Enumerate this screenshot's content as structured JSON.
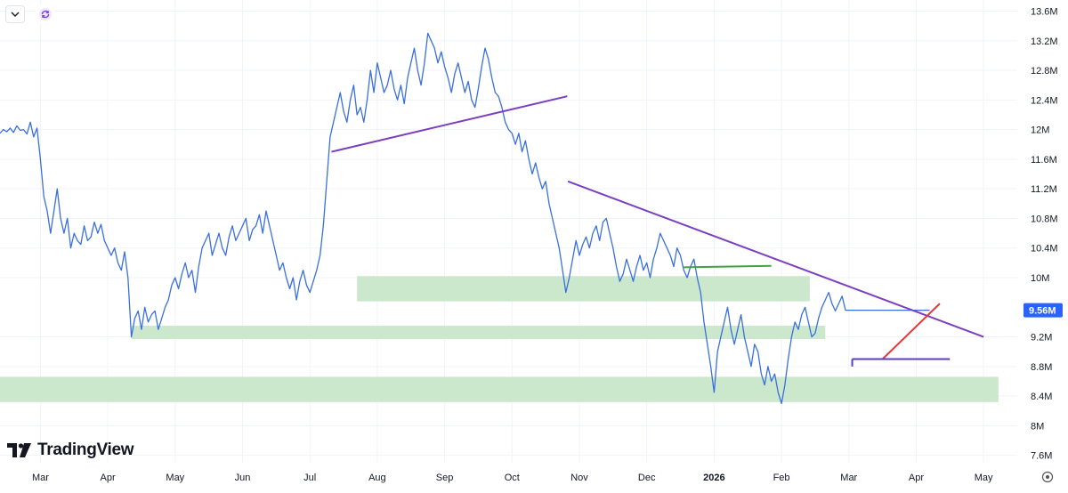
{
  "toolbar": {
    "collapse_icon": "chevron-down-icon",
    "refresh_icon": "refresh-icon"
  },
  "branding": {
    "logo_text": "TradingView",
    "logo_icon": "tradingview-logo-icon"
  },
  "price_axis": {
    "current_price_label": "9.56M",
    "current_price_bg": "#2962ff"
  },
  "settings_icon": "gear-icon",
  "colors": {
    "line": "#3a6fe0",
    "zone": "#c8e6c9",
    "trendline_purple": "#7b3fbf",
    "trendline_green": "#43a047",
    "trendline_red": "#e53935",
    "trendline_indigo": "#5a3ec8",
    "axis_text": "#131722",
    "grid": "#f0f3fa"
  },
  "chart_data": {
    "type": "line",
    "title": "",
    "xlabel": "",
    "ylabel": "",
    "y_tick_labels": [
      "13.6M",
      "13.2M",
      "12.8M",
      "12.4M",
      "12M",
      "11.6M",
      "11.2M",
      "10.8M",
      "10.4M",
      "10M",
      "9.2M",
      "8.8M",
      "8.4M",
      "8M",
      "7.6M"
    ],
    "y_ticks": [
      13.6,
      13.2,
      12.8,
      12.4,
      12.0,
      11.6,
      11.2,
      10.8,
      10.4,
      10.0,
      9.2,
      8.8,
      8.4,
      8.0,
      7.6
    ],
    "ylim": [
      7.5,
      13.75
    ],
    "x_tick_labels": [
      "Mar",
      "Apr",
      "May",
      "Jun",
      "Jul",
      "Aug",
      "Sep",
      "Oct",
      "Nov",
      "Dec",
      "2026",
      "Feb",
      "Mar",
      "Apr",
      "May"
    ],
    "x_tick_months": [
      2,
      3,
      4,
      5,
      6,
      7,
      8,
      9,
      10,
      11,
      12,
      13,
      14,
      15,
      16
    ],
    "x_tick_bold": [
      false,
      false,
      false,
      false,
      false,
      false,
      false,
      false,
      false,
      false,
      true,
      false,
      false,
      false,
      false
    ],
    "xlim": [
      1.4,
      16.5
    ],
    "grid": true,
    "series": [
      {
        "values_x": [
          1.4,
          1.45,
          1.5,
          1.55,
          1.6,
          1.65,
          1.7,
          1.75,
          1.8,
          1.85,
          1.9,
          1.95,
          2.0,
          2.05,
          2.1,
          2.15,
          2.2,
          2.25,
          2.3,
          2.35,
          2.4,
          2.45,
          2.5,
          2.55,
          2.6,
          2.65,
          2.7,
          2.75,
          2.8,
          2.85,
          2.9,
          2.95,
          3.0,
          3.05,
          3.1,
          3.15,
          3.2,
          3.25,
          3.3,
          3.35,
          3.4,
          3.45,
          3.5,
          3.55,
          3.6,
          3.65,
          3.7,
          3.75,
          3.8,
          3.85,
          3.9,
          3.95,
          4.0,
          4.05,
          4.1,
          4.15,
          4.2,
          4.25,
          4.3,
          4.35,
          4.4,
          4.45,
          4.5,
          4.55,
          4.6,
          4.65,
          4.7,
          4.75,
          4.8,
          4.85,
          4.9,
          4.95,
          5.0,
          5.05,
          5.1,
          5.15,
          5.2,
          5.25,
          5.3,
          5.35,
          5.4,
          5.45,
          5.5,
          5.55,
          5.6,
          5.65,
          5.7,
          5.75,
          5.8,
          5.85,
          5.9,
          5.95,
          6.0,
          6.05,
          6.1,
          6.15,
          6.2,
          6.25,
          6.3,
          6.35,
          6.4,
          6.45,
          6.5,
          6.55,
          6.6,
          6.65,
          6.7,
          6.75,
          6.8,
          6.85,
          6.9,
          6.95,
          7.0,
          7.05,
          7.1,
          7.15,
          7.2,
          7.25,
          7.3,
          7.35,
          7.4,
          7.45,
          7.5,
          7.55,
          7.6,
          7.65,
          7.7,
          7.75,
          7.8,
          7.85,
          7.9,
          7.95,
          8.0,
          8.05,
          8.1,
          8.15,
          8.2,
          8.25,
          8.3,
          8.35,
          8.4,
          8.45,
          8.5,
          8.55,
          8.6,
          8.65,
          8.7,
          8.75,
          8.8,
          8.85,
          8.9,
          8.95,
          9.0,
          9.05,
          9.1,
          9.15,
          9.2,
          9.25,
          9.3,
          9.35,
          9.4,
          9.45,
          9.5,
          9.55,
          9.6,
          9.65,
          9.7,
          9.75,
          9.8,
          9.85,
          9.9,
          9.95,
          10.0,
          10.05,
          10.1,
          10.15,
          10.2,
          10.25,
          10.3,
          10.35,
          10.4,
          10.45,
          10.5,
          10.55,
          10.6,
          10.65,
          10.7,
          10.75,
          10.8,
          10.85,
          10.9,
          10.95,
          11.0,
          11.05,
          11.1,
          11.15,
          11.2,
          11.25,
          11.3,
          11.35,
          11.4,
          11.45,
          11.5,
          11.55,
          11.6,
          11.65,
          11.7,
          11.75,
          11.8,
          11.85,
          11.9,
          11.95,
          12.0,
          12.05,
          12.1,
          12.15,
          12.2,
          12.25,
          12.3,
          12.35,
          12.4,
          12.45,
          12.5,
          12.55,
          12.6,
          12.65,
          12.7,
          12.75,
          12.8,
          12.85,
          12.9,
          12.95,
          13.0,
          13.05,
          13.1,
          13.15,
          13.2,
          13.25,
          13.3,
          13.35,
          13.4,
          13.45,
          13.5,
          13.55,
          13.6,
          13.65,
          13.7,
          13.75,
          13.8,
          13.85,
          13.9,
          13.95,
          14.0,
          14.05,
          14.1,
          14.15,
          14.2,
          14.25,
          14.3,
          14.35,
          14.4,
          14.45,
          14.5,
          14.55,
          14.6,
          14.65,
          14.7,
          14.75,
          14.8,
          14.85,
          14.9,
          14.95,
          15.0,
          15.05,
          15.1,
          15.15,
          15.2
        ],
        "values": [
          11.95,
          12.0,
          11.97,
          12.02,
          11.96,
          12.05,
          11.99,
          12.0,
          11.94,
          12.1,
          11.9,
          12.02,
          11.6,
          11.1,
          10.9,
          10.6,
          10.9,
          11.2,
          10.8,
          10.6,
          10.8,
          10.4,
          10.6,
          10.5,
          10.45,
          10.7,
          10.5,
          10.55,
          10.75,
          10.6,
          10.72,
          10.5,
          10.4,
          10.3,
          10.4,
          10.2,
          10.1,
          10.35,
          10.0,
          9.2,
          9.45,
          9.55,
          9.3,
          9.6,
          9.4,
          9.5,
          9.55,
          9.3,
          9.45,
          9.6,
          9.7,
          9.9,
          10.0,
          9.85,
          10.05,
          10.2,
          10.0,
          10.1,
          9.8,
          10.15,
          10.4,
          10.5,
          10.6,
          10.3,
          10.45,
          10.6,
          10.4,
          10.3,
          10.55,
          10.7,
          10.5,
          10.6,
          10.7,
          10.8,
          10.5,
          10.65,
          10.7,
          10.85,
          10.6,
          10.9,
          10.7,
          10.5,
          10.3,
          10.1,
          10.2,
          10.0,
          9.85,
          10.0,
          9.7,
          9.95,
          10.1,
          9.9,
          9.8,
          9.95,
          10.1,
          10.3,
          10.7,
          11.3,
          11.9,
          12.1,
          12.3,
          12.5,
          12.25,
          12.1,
          12.4,
          12.6,
          12.2,
          12.3,
          12.1,
          12.4,
          12.8,
          12.5,
          12.9,
          12.7,
          12.5,
          12.6,
          12.8,
          12.55,
          12.4,
          12.6,
          12.35,
          12.7,
          12.9,
          13.1,
          12.8,
          12.6,
          12.9,
          13.3,
          13.2,
          13.1,
          12.9,
          13.05,
          12.85,
          12.7,
          12.5,
          12.75,
          12.9,
          12.7,
          12.5,
          12.65,
          12.4,
          12.3,
          12.55,
          12.85,
          13.1,
          12.95,
          12.7,
          12.5,
          12.45,
          12.3,
          12.1,
          12.0,
          11.95,
          11.8,
          11.95,
          11.7,
          11.85,
          11.6,
          11.4,
          11.55,
          11.35,
          11.2,
          11.3,
          11.0,
          10.8,
          10.6,
          10.4,
          10.1,
          9.8,
          10.0,
          10.25,
          10.5,
          10.3,
          10.45,
          10.55,
          10.4,
          10.6,
          10.7,
          10.5,
          10.75,
          10.8,
          10.6,
          10.4,
          10.15,
          9.95,
          10.05,
          10.25,
          10.1,
          9.95,
          10.15,
          10.3,
          10.1,
          10.2,
          10.0,
          10.25,
          10.4,
          10.6,
          10.5,
          10.4,
          10.3,
          10.15,
          10.4,
          10.3,
          10.1,
          10.0,
          10.15,
          10.25,
          10.0,
          9.8,
          9.4,
          9.1,
          8.8,
          8.45,
          9.0,
          9.2,
          9.4,
          9.6,
          9.3,
          9.1,
          9.3,
          9.5,
          9.2,
          9.0,
          8.8,
          9.1,
          9.0,
          8.7,
          8.55,
          8.8,
          8.6,
          8.7,
          8.45,
          8.3,
          8.55,
          8.9,
          9.2,
          9.4,
          9.3,
          9.5,
          9.6,
          9.4,
          9.2,
          9.25,
          9.45,
          9.6,
          9.7,
          9.8,
          9.65,
          9.55,
          9.65,
          9.75,
          9.56,
          9.56,
          9.56,
          9.56,
          9.56,
          9.56,
          9.56,
          9.56,
          9.56,
          9.56,
          9.56,
          9.56,
          9.56,
          9.56,
          9.56,
          9.56,
          9.56,
          9.56,
          9.56,
          9.56,
          9.56,
          9.56,
          9.56,
          9.56,
          9.56,
          9.56,
          9.56,
          9.56,
          9.56,
          9.56
        ]
      }
    ],
    "zones": [
      {
        "x_start": 6.7,
        "x_end": 13.42,
        "y_low": 9.68,
        "y_high": 10.02
      },
      {
        "x_start": 3.35,
        "x_end": 13.65,
        "y_low": 9.17,
        "y_high": 9.35
      },
      {
        "x_start": 1.4,
        "x_end": 16.22,
        "y_low": 8.32,
        "y_high": 8.66
      }
    ],
    "trendlines": [
      {
        "color": "purple",
        "x1": 6.32,
        "y1": 11.7,
        "x2": 9.82,
        "y2": 12.45
      },
      {
        "color": "purple",
        "x1": 9.83,
        "y1": 11.3,
        "x2": 16.0,
        "y2": 9.2
      },
      {
        "color": "green",
        "x1": 11.55,
        "y1": 10.14,
        "x2": 12.85,
        "y2": 10.16
      },
      {
        "color": "red",
        "x1": 14.5,
        "y1": 8.9,
        "x2": 15.35,
        "y2": 9.65
      },
      {
        "color": "indigo",
        "x1": 14.05,
        "y1": 8.9,
        "x2": 15.5,
        "y2": 8.9
      },
      {
        "color": "indigo",
        "x1": 14.05,
        "y1": 8.8,
        "x2": 14.05,
        "y2": 8.9
      }
    ]
  }
}
